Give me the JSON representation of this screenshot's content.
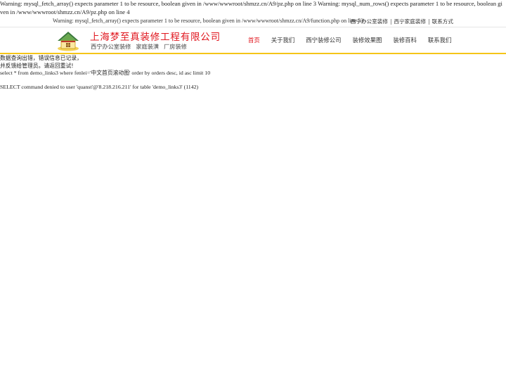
{
  "warnings": {
    "top": "Warning: mysql_fetch_array() expects parameter 1 to be resource, boolean given in /www/wwwroot/shmzz.cn/A9/pz.php on line 3 Warning: mysql_num_rows() expects parameter 1 to be resource, boolean given in /www/wwwroot/shmzz.cn/A9/pz.php on line 4",
    "function": "Warning: mysql_fetch_array() expects parameter 1 to be resource, boolean given in /www/wwwroot/shmzz.cn/A9/function.php on line 53"
  },
  "top_links": {
    "office": "西宁办公室装修",
    "home": "西宁家庭装修",
    "contact": "联系方式",
    "separator": "|"
  },
  "header": {
    "company_name": "上海梦至真装修工程有限公司",
    "tags": [
      "西宁办公室装修",
      "家庭装潢",
      "厂房装修"
    ]
  },
  "nav": {
    "items": [
      "首页",
      "关于我们",
      "西宁装修公司",
      "装修效果图",
      "装修百科",
      "联系我们"
    ],
    "active_index": 0
  },
  "error": {
    "line1": "数据查询出错，错误信息已记录，",
    "line2": "并反馈给管理员。请返回重试!",
    "sql": "select * from demo_links3 where fenlei='中文首页滚动图' order by orders desc, id asc limit 10",
    "denied": "SELECT command denied to user 'quanst'@'8.218.216.211' for table 'demo_links3' (1142)"
  },
  "colors": {
    "brand_red": "#e0161e",
    "accent_yellow": "#f5c518"
  }
}
